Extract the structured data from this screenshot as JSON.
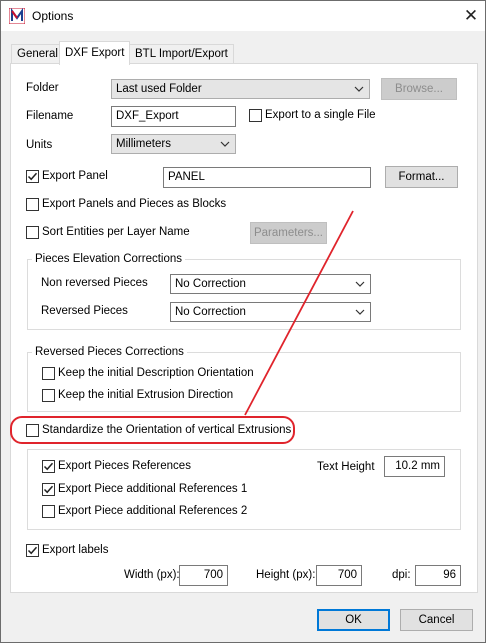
{
  "window": {
    "title": "Options",
    "colors": {
      "annotation": "#e0242c",
      "focus": "#0078d7"
    }
  },
  "tabs": [
    {
      "label": "General"
    },
    {
      "label": "DXF Export"
    },
    {
      "label": "BTL Import/Export"
    }
  ],
  "folder": {
    "label": "Folder",
    "value": "Last used Folder",
    "browse": "Browse..."
  },
  "filename": {
    "label": "Filename",
    "value": "DXF_Export",
    "single_file": "Export to a single File"
  },
  "units": {
    "label": "Units",
    "value": "Millimeters"
  },
  "export_panel": {
    "label": "Export Panel",
    "value": "PANEL",
    "format": "Format..."
  },
  "options": {
    "blocks": "Export Panels and Pieces as Blocks",
    "sort_layer": "Sort Entities per Layer Name",
    "parameters": "Parameters..."
  },
  "elevation": {
    "title": "Pieces Elevation Corrections",
    "non_reversed_label": "Non reversed Pieces",
    "non_reversed_value": "No Correction",
    "reversed_label": "Reversed Pieces",
    "reversed_value": "No Correction"
  },
  "reversed": {
    "title": "Reversed Pieces Corrections",
    "keep_orientation": "Keep the initial Description Orientation",
    "keep_extrusion": "Keep the initial Extrusion Direction"
  },
  "standardize": {
    "label": "Standardize the Orientation of vertical Extrusions"
  },
  "references": {
    "export_refs": "Export Pieces References",
    "additional_1": "Export Piece additional References 1",
    "additional_2": "Export Piece additional References 2",
    "text_height_label": "Text Height",
    "text_height_value": "10.2 mm"
  },
  "labels": {
    "export_labels": "Export labels",
    "width_label": "Width (px):",
    "width_value": "700",
    "height_label": "Height (px):",
    "height_value": "700",
    "dpi_label": "dpi:",
    "dpi_value": "96"
  },
  "footer": {
    "ok": "OK",
    "cancel": "Cancel"
  }
}
